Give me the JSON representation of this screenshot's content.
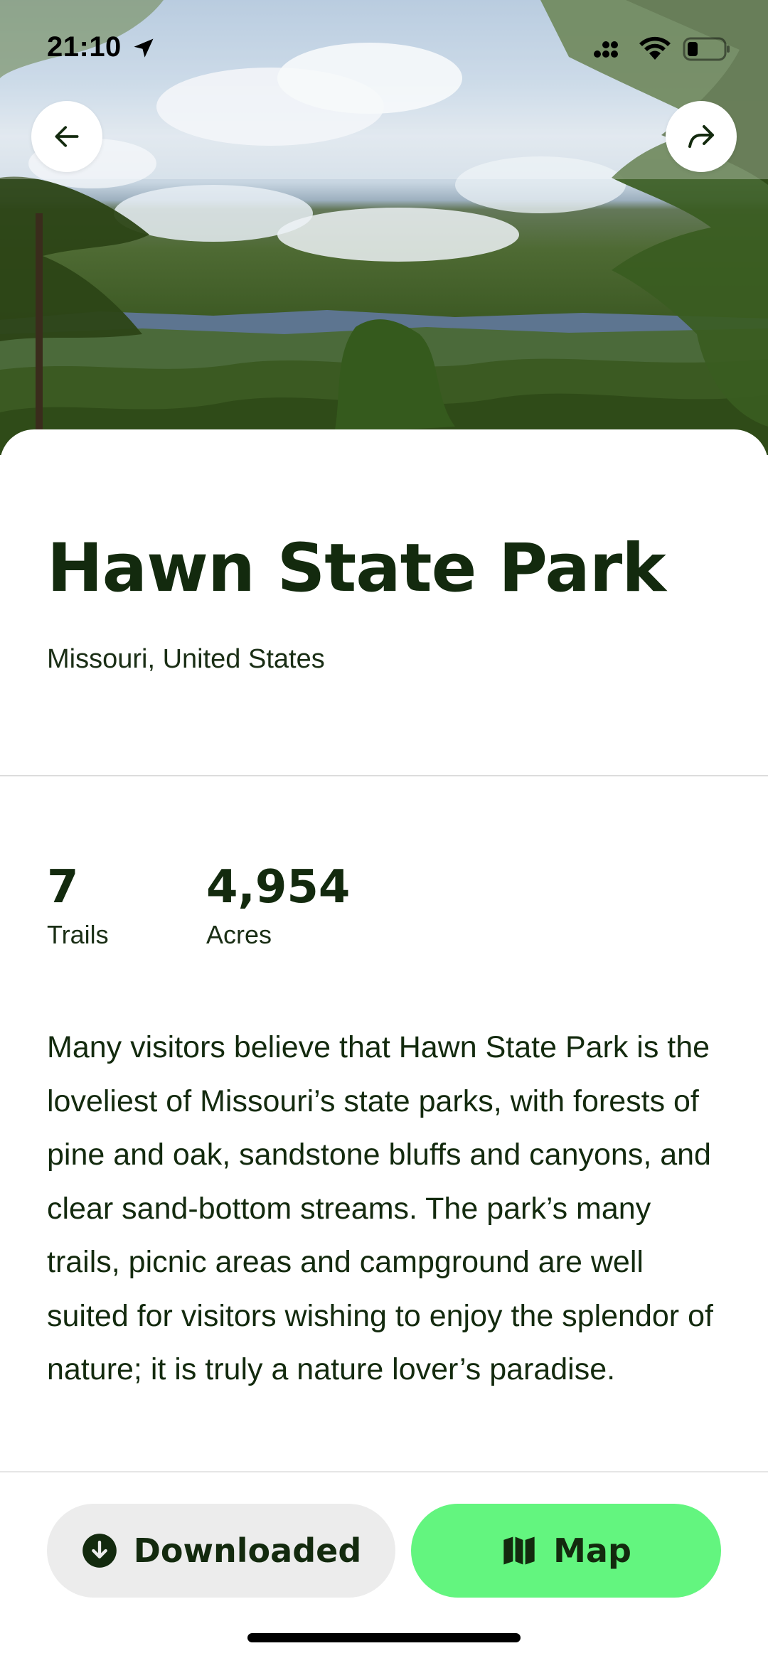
{
  "status_bar": {
    "time": "21:10"
  },
  "park": {
    "name": "Hawn State Park",
    "location": "Missouri, United States",
    "description": "Many visitors believe that Hawn State Park is the loveliest of Missouri’s state parks, with forests of pine and oak, sandstone bluffs and canyons, and clear sand-bottom streams. The park’s many trails, picnic areas and campground are well suited for visitors wishing to enjoy the splendor of nature; it is truly a nature lover’s paradise."
  },
  "stats": [
    {
      "value": "7",
      "label": "Trails"
    },
    {
      "value": "4,954",
      "label": "Acres"
    }
  ],
  "actions": {
    "downloaded_label": "Downloaded",
    "map_label": "Map"
  },
  "icons": {
    "back": "arrow-left-icon",
    "share": "share-arrow-icon",
    "downloaded": "download-circle-icon",
    "map": "folded-map-icon"
  },
  "colors": {
    "title": "#132a0e",
    "map_button": "#63f57f",
    "downloaded_button": "#ececec"
  }
}
